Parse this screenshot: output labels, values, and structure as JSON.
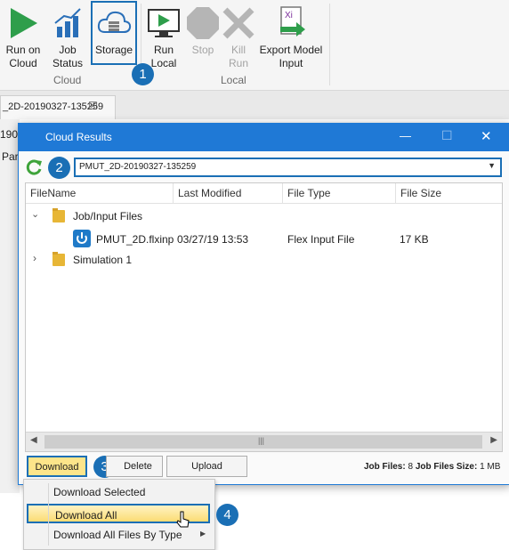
{
  "ribbon": {
    "buttons": [
      {
        "label": "Run on\nCloud"
      },
      {
        "label": "Job\nStatus"
      },
      {
        "label": "Storage"
      },
      {
        "label": "Run\nLocal"
      },
      {
        "label": "Stop"
      },
      {
        "label": "Kill\nRun"
      },
      {
        "label": "Export Model\nInput"
      }
    ],
    "groups": {
      "cloud": "Cloud",
      "local": "Local"
    }
  },
  "background": {
    "tab_label": "_2D-20190327-135259",
    "tab_close": "☒",
    "partial_1": "190",
    "partial_2": "Par"
  },
  "dialog": {
    "title": "Cloud Results",
    "minimize": "—",
    "maximize": "☐",
    "close": "✕",
    "job_select": "PMUT_2D-20190327-135259",
    "columns": [
      "FileName",
      "Last Modified",
      "File Type",
      "File Size"
    ],
    "rows": {
      "folder_1": "Job/Input Files",
      "file_1": {
        "name": "PMUT_2D.flxinp",
        "modified": "03/27/19 13:53",
        "type": "Flex Input File",
        "size": "17 KB"
      },
      "folder_2": "Simulation 1"
    },
    "scrollbar_grip": "|||",
    "buttons": {
      "download": "Download",
      "delete": "Delete",
      "upload": "Upload"
    },
    "status": {
      "job_files_label": "Job Files:",
      "job_files_value": "8",
      "size_label": "Job Files Size:",
      "size_value": "1 MB"
    }
  },
  "menu": {
    "items": [
      "Download Selected",
      "Download All",
      "Download All Files By Type"
    ]
  },
  "callouts": [
    "1",
    "2",
    "3",
    "4"
  ],
  "colors": {
    "accent": "#1f79d6",
    "callout": "#1a6fb5",
    "highlight": "#fde58a"
  }
}
